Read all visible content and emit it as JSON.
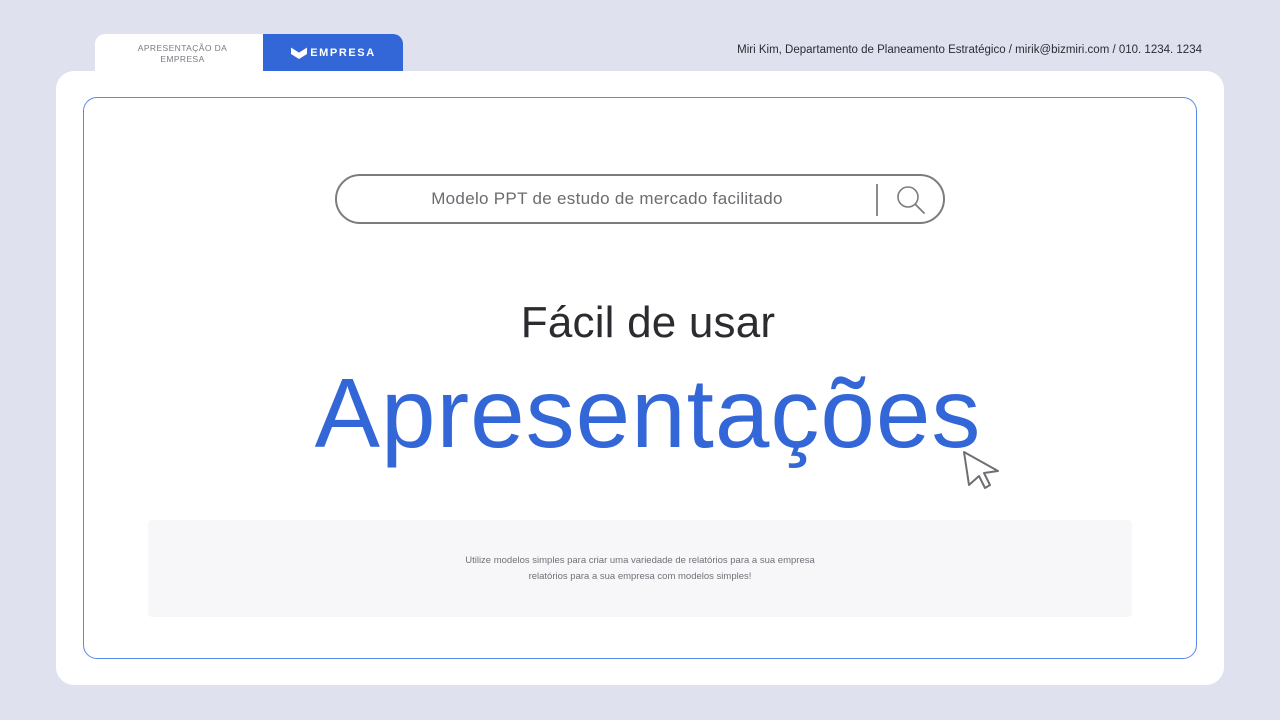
{
  "header": {
    "tab_label_line1": "APRESENTAÇÃO DA",
    "tab_label_line2": "EMPRESA",
    "brand_label": "EMPRESA",
    "contact_info": "Miri Kim, Departamento de Planeamento Estratégico / mirik@bizmiri.com / 010. 1234. 1234"
  },
  "search": {
    "placeholder": "Modelo PPT de estudo de mercado facilitado",
    "icon": "search-icon"
  },
  "hero": {
    "subtitle": "Fácil de usar",
    "title": "Apresentações"
  },
  "description": {
    "line1": "Utilize modelos simples para criar uma variedade de relatórios para a sua empresa",
    "line2": "relatórios para a sua empresa com modelos simples!"
  },
  "colors": {
    "accent": "#3366d6",
    "background": "#dfe1ee",
    "frame": "#5b8ae6"
  }
}
